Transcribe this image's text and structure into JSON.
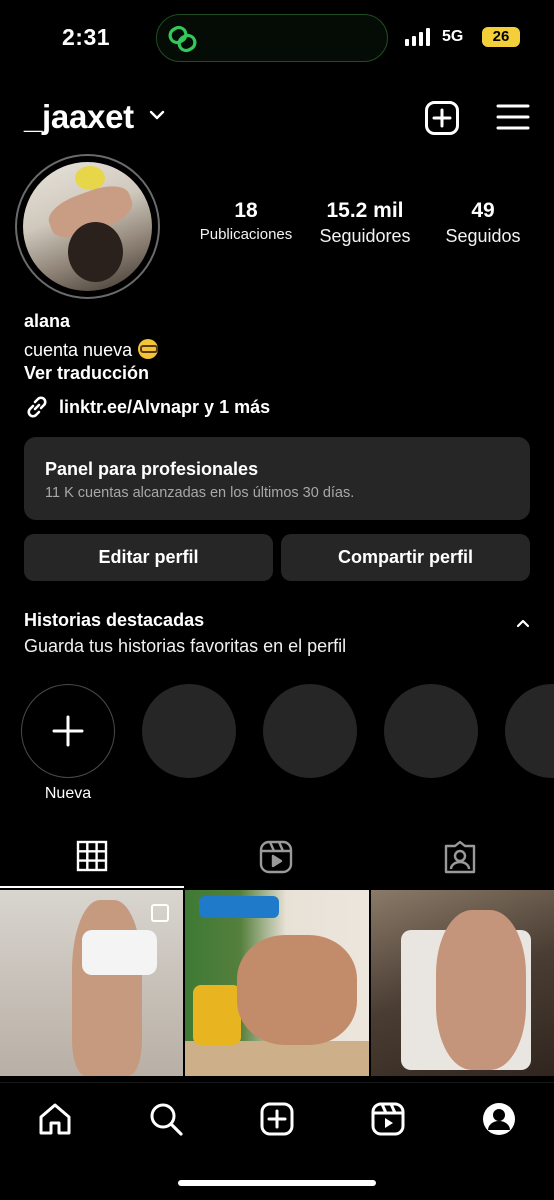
{
  "status_bar": {
    "time": "2:31",
    "network": "5G",
    "battery": "26"
  },
  "header": {
    "username": "_jaaxet"
  },
  "stats": [
    {
      "value": "18",
      "label": "Publicaciones"
    },
    {
      "value": "15.2 mil",
      "label": "Seguidores"
    },
    {
      "value": "49",
      "label": "Seguidos"
    }
  ],
  "bio": {
    "name": "alana",
    "text": "cuenta nueva",
    "translate": "Ver traducción",
    "link": "linktr.ee/Alvnapr y 1 más"
  },
  "pro_panel": {
    "title": "Panel para profesionales",
    "subtitle": "11 K cuentas alcanzadas en los últimos 30 días."
  },
  "buttons": {
    "edit": "Editar perfil",
    "share": "Compartir perfil"
  },
  "highlights": {
    "title": "Historias destacadas",
    "subtitle": "Guarda tus historias favoritas en el perfil",
    "new_label": "Nueva"
  },
  "colors": {
    "background": "#000000",
    "surface": "#262626",
    "battery": "#f3d03a",
    "island_accent": "#34c759"
  },
  "icons": {
    "header": [
      "chevron-down-icon",
      "create-icon",
      "menu-icon"
    ],
    "tabs": [
      "grid-icon",
      "reels-icon",
      "tagged-icon"
    ],
    "nav": [
      "home-icon",
      "search-icon",
      "create-icon",
      "reels-icon",
      "profile-icon"
    ]
  }
}
